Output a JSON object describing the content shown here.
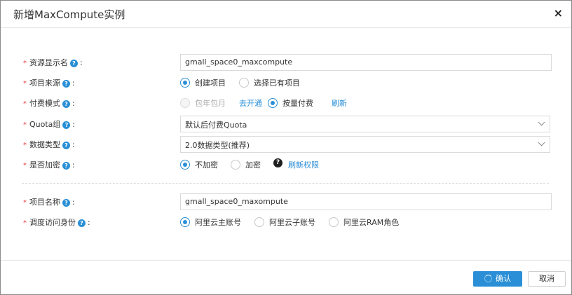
{
  "dialog": {
    "title": "新增MaxCompute实例",
    "close_label": "×"
  },
  "help_glyph": "?",
  "question_glyph": "?",
  "colon": ":",
  "required_mark": "*",
  "fields": {
    "display_name": {
      "label": "资源显示名",
      "value": "gmall_space0_maxcompute"
    },
    "project_source": {
      "label": "项目来源",
      "options": [
        "创建项目",
        "选择已有项目"
      ],
      "selected": "创建项目"
    },
    "payment_mode": {
      "label": "付费模式",
      "options": [
        "包年包月",
        "按量付费"
      ],
      "selected": "按量付费",
      "activate_link": "去开通",
      "refresh_link": "刷新"
    },
    "quota_group": {
      "label": "Quota组",
      "value": "默认后付费Quota"
    },
    "data_type": {
      "label": "数据类型",
      "value": "2.0数据类型(推荐)"
    },
    "encryption": {
      "label": "是否加密",
      "options": [
        "不加密",
        "加密"
      ],
      "selected": "不加密",
      "refresh_perm_link": "刷新权限"
    },
    "project_name": {
      "label": "项目名称",
      "value": "gmall_space0_maxompute"
    },
    "schedule_identity": {
      "label": "调度访问身份",
      "options": [
        "阿里云主账号",
        "阿里云子账号",
        "阿里云RAM角色"
      ],
      "selected": "阿里云主账号"
    }
  },
  "footer": {
    "confirm_label": "确认",
    "cancel_label": "取消"
  },
  "colors": {
    "accent": "#2a8fd6",
    "required": "#e4393c"
  }
}
